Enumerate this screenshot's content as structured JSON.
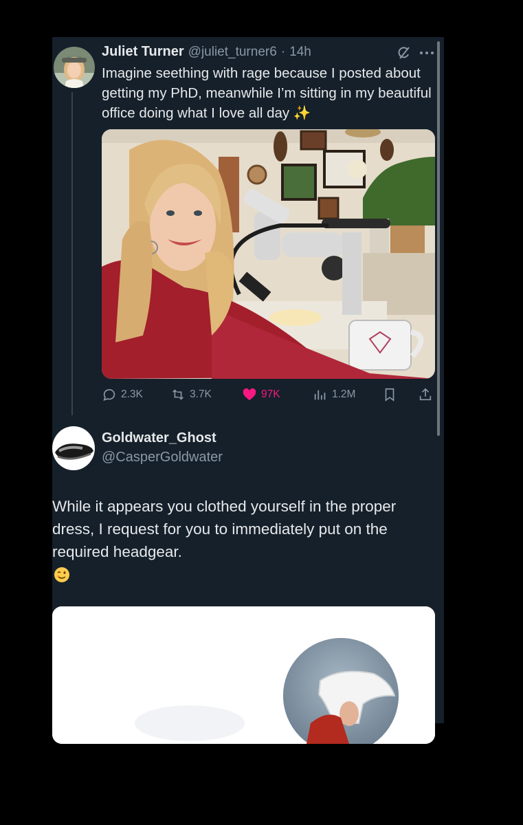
{
  "tweet": {
    "author_name": "Juliet Turner",
    "handle": "@juliet_turner6",
    "separator": "·",
    "time": "14h",
    "text": "Imagine seething with rage because I posted about getting my PhD, meanwhile I’m sitting in my beautiful office doing what I love all day ✨",
    "actions": {
      "replies": "2.3K",
      "reposts": "3.7K",
      "likes": "97K",
      "views": "1.2M"
    }
  },
  "reply": {
    "author_name": "Goldwater_Ghost",
    "handle": "@CasperGoldwater",
    "text": "While it appears you clothed yourself in the proper dress, I request for you to immediately put on the required headgear.",
    "emoji": "winking-face"
  },
  "colors": {
    "background": "#15202b",
    "text": "#e7e9ea",
    "secondary": "#8b98a5",
    "like": "#f91880"
  },
  "icons": [
    "grok-icon",
    "more-icon",
    "reply-icon",
    "repost-icon",
    "heart-icon",
    "views-icon",
    "bookmark-icon",
    "share-icon"
  ]
}
